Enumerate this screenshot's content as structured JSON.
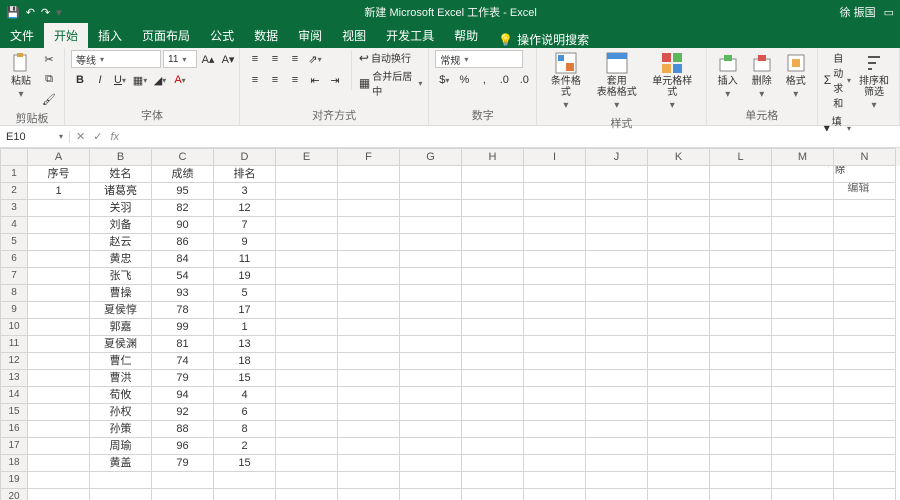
{
  "titlebar": {
    "title": "新建 Microsoft Excel 工作表 - Excel",
    "user": "徐 振国"
  },
  "tabs": {
    "file": "文件",
    "home": "开始",
    "insert": "插入",
    "layout": "页面布局",
    "formulas": "公式",
    "data": "数据",
    "review": "审阅",
    "view": "视图",
    "dev": "开发工具",
    "help": "帮助",
    "tell": "操作说明搜索"
  },
  "ribbon": {
    "clipboard": {
      "paste": "粘贴",
      "group": "剪贴板"
    },
    "font": {
      "name": "等线",
      "size": "11",
      "group": "字体"
    },
    "align": {
      "wrap": "自动换行",
      "merge": "合并后居中",
      "group": "对齐方式"
    },
    "number": {
      "format": "常规",
      "group": "数字"
    },
    "styles": {
      "cond": "条件格式",
      "table": "套用\n表格格式",
      "cell": "单元格样式",
      "group": "样式"
    },
    "cells": {
      "insert": "插入",
      "delete": "删除",
      "format": "格式",
      "group": "单元格"
    },
    "editing": {
      "sum": "自动求和",
      "fill": "填充",
      "clear": "清除",
      "sort": "排序和\n筛选",
      "group": "编辑"
    }
  },
  "namebox": {
    "ref": "E10",
    "fx": "fx"
  },
  "columns": [
    "A",
    "B",
    "C",
    "D",
    "E",
    "F",
    "G",
    "H",
    "I",
    "J",
    "K",
    "L",
    "M",
    "N"
  ],
  "headers": {
    "A": "序号",
    "B": "姓名",
    "C": "成绩",
    "D": "排名"
  },
  "data": [
    {
      "A": "1",
      "B": "诸葛亮",
      "C": "95",
      "D": "3"
    },
    {
      "A": "",
      "B": "关羽",
      "C": "82",
      "D": "12"
    },
    {
      "A": "",
      "B": "刘备",
      "C": "90",
      "D": "7"
    },
    {
      "A": "",
      "B": "赵云",
      "C": "86",
      "D": "9"
    },
    {
      "A": "",
      "B": "黄忠",
      "C": "84",
      "D": "11"
    },
    {
      "A": "",
      "B": "张飞",
      "C": "54",
      "D": "19"
    },
    {
      "A": "",
      "B": "曹操",
      "C": "93",
      "D": "5"
    },
    {
      "A": "",
      "B": "夏侯惇",
      "C": "78",
      "D": "17"
    },
    {
      "A": "",
      "B": "郭嘉",
      "C": "99",
      "D": "1"
    },
    {
      "A": "",
      "B": "夏侯渊",
      "C": "81",
      "D": "13"
    },
    {
      "A": "",
      "B": "曹仁",
      "C": "74",
      "D": "18"
    },
    {
      "A": "",
      "B": "曹洪",
      "C": "79",
      "D": "15"
    },
    {
      "A": "",
      "B": "荀攸",
      "C": "94",
      "D": "4"
    },
    {
      "A": "",
      "B": "孙权",
      "C": "92",
      "D": "6"
    },
    {
      "A": "",
      "B": "孙策",
      "C": "88",
      "D": "8"
    },
    {
      "A": "",
      "B": "周瑜",
      "C": "96",
      "D": "2"
    },
    {
      "A": "",
      "B": "黄盖",
      "C": "79",
      "D": "15"
    }
  ]
}
